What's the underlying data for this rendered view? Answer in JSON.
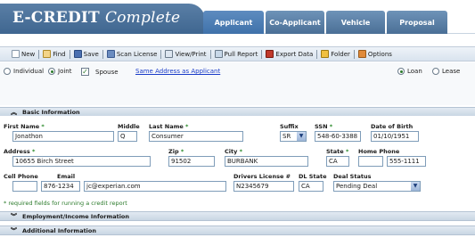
{
  "brand": {
    "title_main": "E-CREDIT",
    "title_italic": "Complete"
  },
  "tabs": [
    {
      "label": "Applicant",
      "active": true
    },
    {
      "label": "Co-Applicant",
      "active": false
    },
    {
      "label": "Vehicle",
      "active": false
    },
    {
      "label": "Proposal",
      "active": false
    }
  ],
  "toolbar": {
    "new": "New",
    "find": "Find",
    "save": "Save",
    "scan": "Scan License",
    "view_print": "View/Print",
    "pull_report": "Pull Report",
    "export": "Export Data",
    "folder": "Folder",
    "options": "Options"
  },
  "applicant_type": {
    "individual": "Individual",
    "joint": "Joint",
    "selected": "Joint",
    "spouse_checked": true,
    "spouse_label": "Spouse",
    "same_address_link": "Same Address as Applicant"
  },
  "deal_type": {
    "loan": "Loan",
    "lease": "Lease",
    "selected": "Loan"
  },
  "sections": {
    "basic": "Basic Information",
    "employment": "Employment/Income Information",
    "additional": "Additional Information"
  },
  "labels": {
    "first_name": "First Name",
    "middle": "Middle",
    "last_name": "Last Name",
    "suffix": "Suffix",
    "ssn": "SSN",
    "dob": "Date of Birth",
    "address": "Address",
    "zip": "Zip",
    "city": "City",
    "state": "State",
    "home_phone": "Home Phone",
    "cell_phone": "Cell Phone",
    "email": "Email",
    "drivers_license": "Drivers License #",
    "dl_state": "DL State",
    "deal_status": "Deal Status",
    "required_mark": "*"
  },
  "values": {
    "first_name": "Jonathon",
    "middle": "Q",
    "last_name": "Consumer",
    "suffix": "SR",
    "ssn": "548-60-3388",
    "dob": "01/10/1951",
    "address": "10655 Birch Street",
    "zip": "91502",
    "city": "BURBANK",
    "state": "CA",
    "home_phone_area": "",
    "home_phone_number": "555-1111",
    "cell_phone_area": "",
    "cell_phone_number": "876-1234",
    "email": "jc@experian.com",
    "drivers_license": "N2345679",
    "dl_state": "CA",
    "deal_status": "Pending Deal"
  },
  "required_note": "* required fields for running a credit report",
  "colors": {
    "brand_blue": "#4a6f96",
    "required_green": "#2a8a2a",
    "link_blue": "#1a3cc8"
  }
}
